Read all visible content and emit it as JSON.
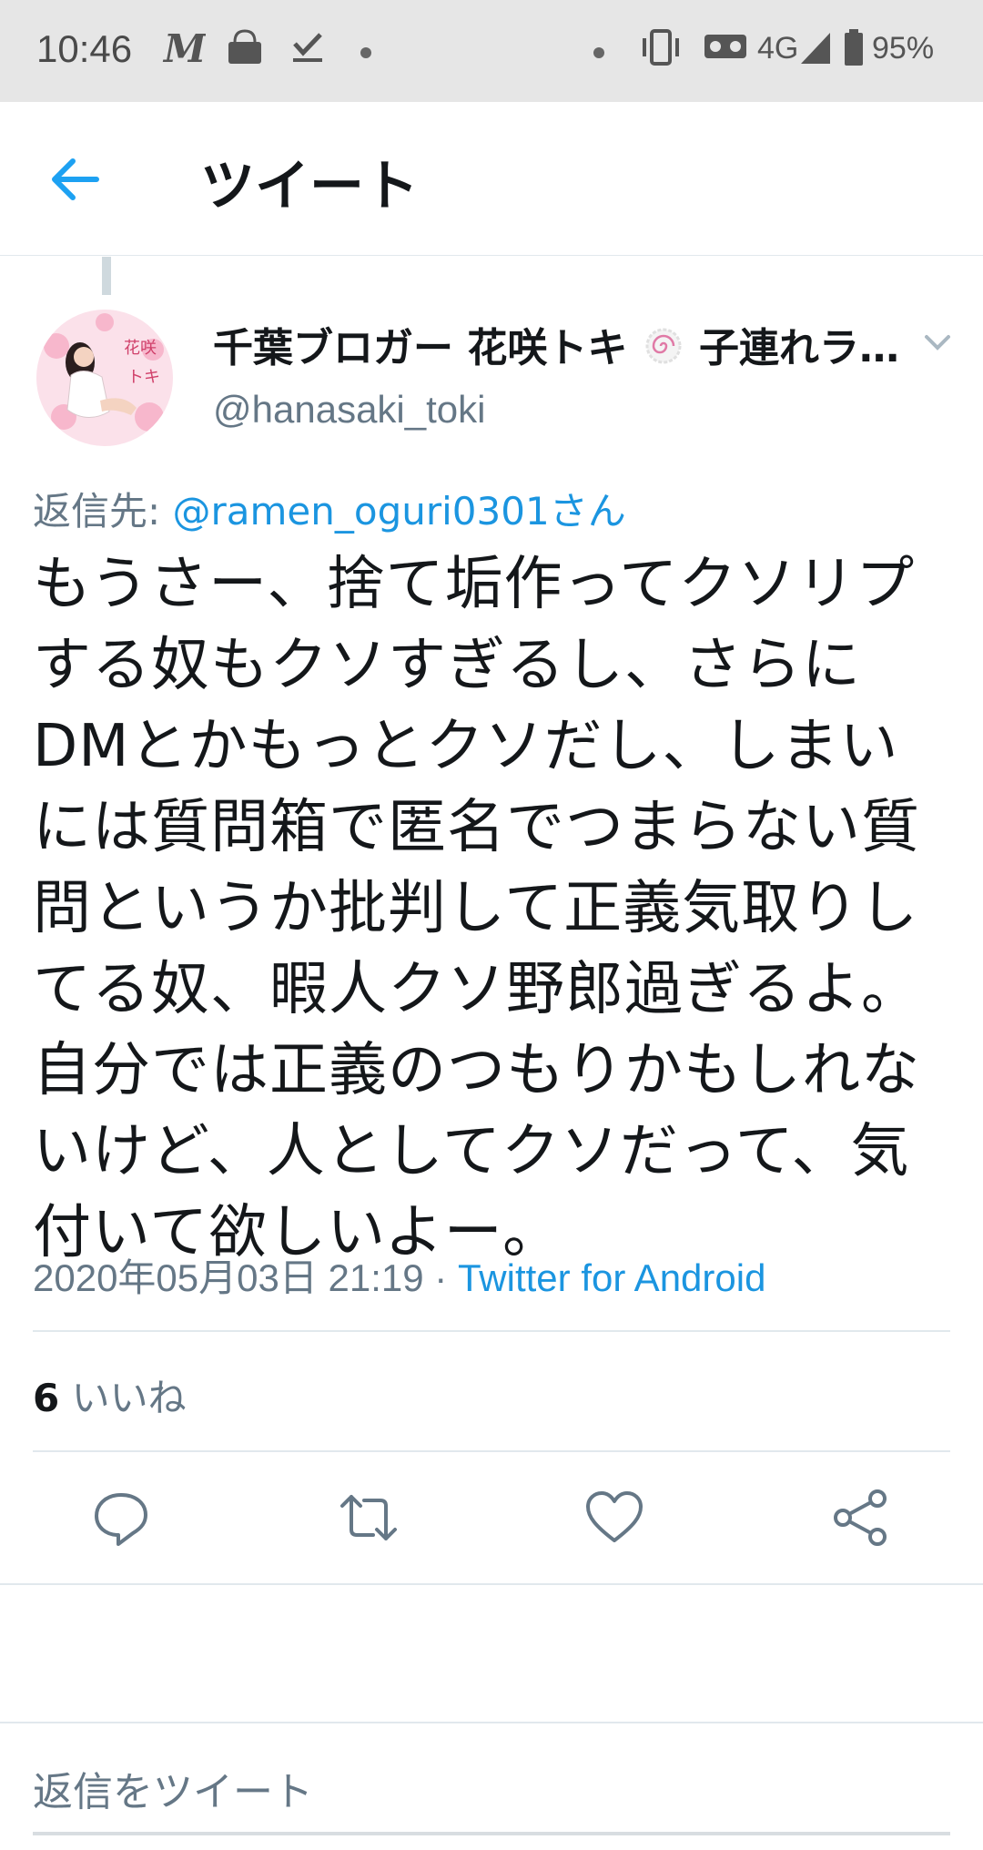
{
  "status_bar": {
    "time": "10:46",
    "network": "4G",
    "battery": "95%",
    "icons": [
      "mercari-icon",
      "market-bag-icon",
      "download-done-icon",
      "dot-icon",
      "dot-icon",
      "vibrate-icon",
      "vr-icon",
      "signal-icon",
      "battery-icon"
    ]
  },
  "header": {
    "title": "ツイート",
    "back_icon": "back-arrow-icon"
  },
  "tweet": {
    "author": {
      "display_name": "千葉ブロガー 花咲トキ",
      "display_name_suffix": "子連れラ…",
      "handle": "@hanasaki_toki",
      "avatar_text_1": "花咲",
      "avatar_text_2": "トキ"
    },
    "reply_to_label": "返信先: ",
    "reply_to_mention": "@ramen_oguri0301さん",
    "text": "もうさー、捨て垢作ってクソリプする奴もクソすぎるし、さらにDMとかもっとクソだし、しまいには質問箱で匿名でつまらない質問というか批判して正義気取りしてる奴、暇人クソ野郎過ぎるよ。自分では正義のつもりかもしれないけど、人としてクソだって、気付いて欲しいよー。",
    "timestamp": "2020年05月03日 21:19",
    "separator": " · ",
    "source": "Twitter for Android",
    "likes_count": "6",
    "likes_label": " いいね"
  },
  "actions": [
    "reply-icon",
    "retweet-icon",
    "like-icon",
    "share-icon"
  ],
  "reply_box": {
    "placeholder": "返信をツイート"
  },
  "colors": {
    "accent": "#1b95e0",
    "text": "#14171a",
    "secondary": "#657786",
    "divider": "#e1e8ed",
    "statusbar": "#e6e6e6"
  }
}
